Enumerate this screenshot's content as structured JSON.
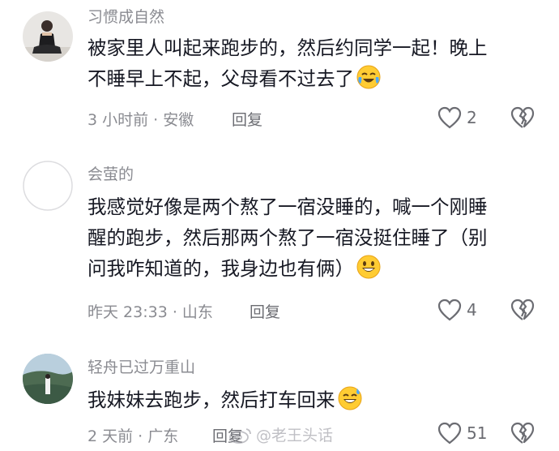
{
  "comments": [
    {
      "username": "习惯成自然",
      "lines": [
        "被家里人叫起来跑步的，然后约同学一起！晚上",
        "不睡早上不起，父母看不过去了"
      ],
      "emoji": "crying-laughing-emoji",
      "meta": "3 小时前 · 安徽",
      "reply": "回复",
      "likes": "2"
    },
    {
      "username": "会萤的",
      "lines": [
        "我感觉好像是两个熬了一宿没睡的，喊一个刚睡",
        "醒的跑步，然后那两个熬了一宿没挺住睡了（别",
        "问我咋知道的，我身边也有俩）"
      ],
      "emoji": "grinning-emoji",
      "meta": "昨天 23:33 · 山东",
      "reply": "回复",
      "likes": "4"
    },
    {
      "username": "轻舟已过万重山",
      "lines": [
        "我妹妹去跑步，然后打车回来"
      ],
      "emoji": "sweat-smile-emoji",
      "meta": "2 天前 · 广东",
      "reply": "回复",
      "likes": "51"
    }
  ],
  "watermark": "@老王头话",
  "colors": {
    "meta": "#8a8b91",
    "text": "#161823",
    "icon": "#6b6c72"
  }
}
